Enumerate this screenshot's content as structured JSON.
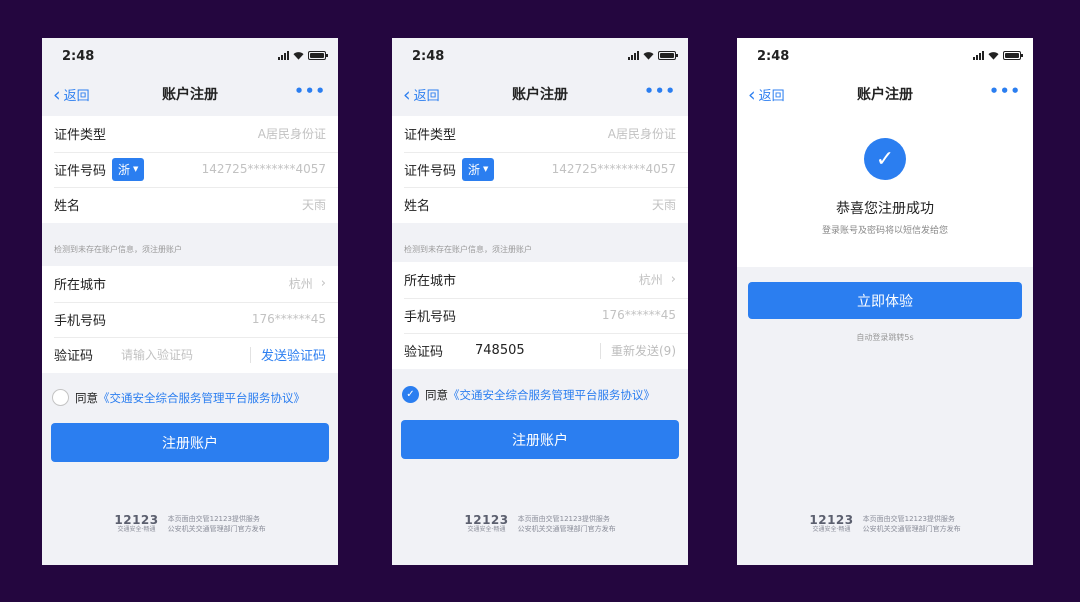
{
  "status": {
    "time": "2:48"
  },
  "nav": {
    "back": "返回",
    "title": "账户注册",
    "more": "•••"
  },
  "form": {
    "id_type_label": "证件类型",
    "id_type_value": "A居民身份证",
    "id_no_label": "证件号码",
    "province": "浙",
    "id_no_value": "142725********4057",
    "name_label": "姓名",
    "name_value": "天雨",
    "hint": "检测到未存在账户信息，须注册账户",
    "city_label": "所在城市",
    "city_value": "杭州",
    "phone_label": "手机号码",
    "phone_value": "176******45",
    "code_label": "验证码",
    "code_placeholder": "请输入验证码",
    "send_code": "发送验证码",
    "code_value": "748505",
    "resend": "重新发送(9)",
    "agree_prefix": "同意",
    "agree_link": "《交通安全综合服务管理平台服务协议》",
    "submit": "注册账户"
  },
  "success": {
    "title": "恭喜您注册成功",
    "subtitle": "登录账号及密码将以短信发给您",
    "button": "立即体验",
    "redirect": "自动登录跳转5s"
  },
  "footer": {
    "logo": "12123",
    "logo_sub": "交通安全·畅通",
    "line1": "本页面由交管12123提供服务",
    "line2": "公安机关交通管理部门官方发布"
  },
  "colors": {
    "background": "#24063f",
    "accent": "#2b7ef0",
    "screen_bg": "#f1f2f6"
  },
  "icons": [
    "back-chevron-icon",
    "more-icon",
    "signal-icon",
    "wifi-icon",
    "battery-icon",
    "caret-down-icon",
    "chevron-right-icon",
    "checkbox-icon",
    "check-icon"
  ]
}
